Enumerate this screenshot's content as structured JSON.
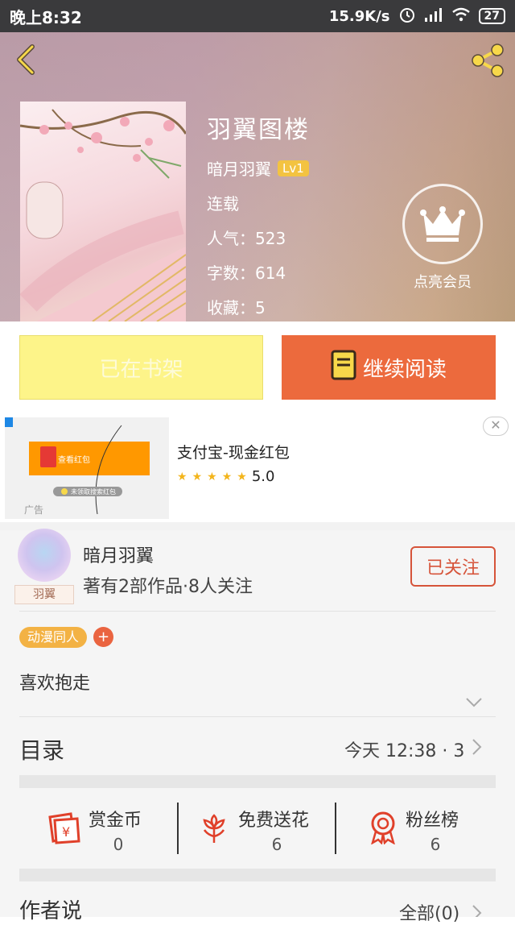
{
  "status_bar": {
    "time": "晚上8:32",
    "speed": "15.9K/s",
    "battery": "27"
  },
  "book": {
    "title": "羽翼图楼",
    "author": "暗月羽翼",
    "level": "Lv1",
    "status": "连载",
    "popularity": "人气：523",
    "word_count": "字数：614",
    "favorites": "收藏：5"
  },
  "vip": {
    "label": "点亮会员"
  },
  "actions": {
    "shelf_label": "已在书架",
    "read_label": "继续阅读"
  },
  "ad": {
    "image_button": "查看红包",
    "image_note": "未领取搜索红包",
    "badge": "广告",
    "title": "支付宝-现金红包",
    "rating": "5.0",
    "stars": 5
  },
  "author": {
    "name": "暗月羽翼",
    "stats": "著有2部作品·8人关注",
    "avatar_tag": "羽翼",
    "follow_label": "已关注"
  },
  "tags": {
    "items": [
      "动漫同人"
    ],
    "add": "+"
  },
  "description": "喜欢抱走",
  "toc": {
    "label": "目录",
    "latest": "今天 12:38 · 3"
  },
  "stats": [
    {
      "label": "赏金币",
      "value": "0",
      "icon": "coin-icon"
    },
    {
      "label": "免费送花",
      "value": "6",
      "icon": "flower-icon"
    },
    {
      "label": "粉丝榜",
      "value": "6",
      "icon": "medal-icon"
    }
  ],
  "author_says": {
    "label": "作者说",
    "all": "全部(0)"
  },
  "colors": {
    "accent": "#ec6a3d",
    "shelf_yellow": "#fdf489",
    "tag_orange": "#f3b244"
  }
}
